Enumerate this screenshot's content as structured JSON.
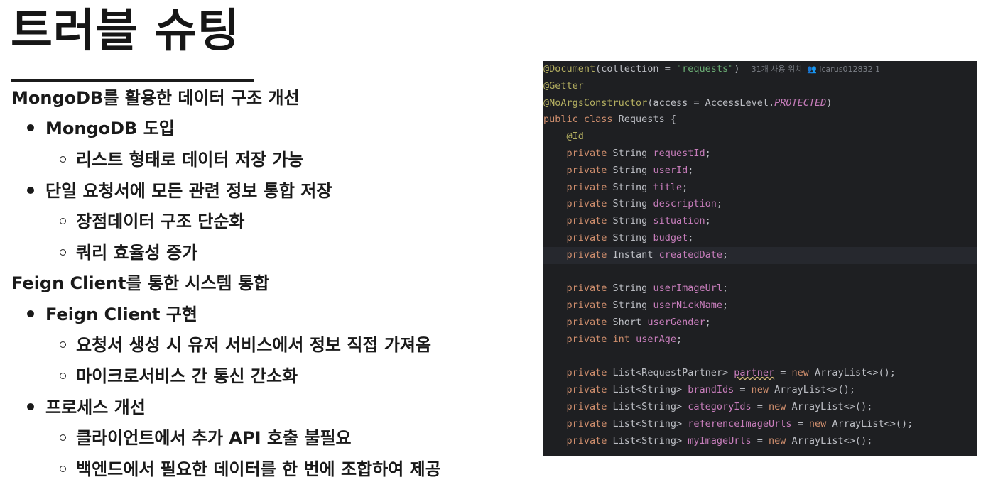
{
  "title": "트러블 슈팅",
  "outline": [
    {
      "level": 0,
      "text": "MongoDB를 활용한 데이터 구조 개선"
    },
    {
      "level": 1,
      "text": "MongoDB 도입"
    },
    {
      "level": 2,
      "text": "리스트 형태로 데이터 저장 가능"
    },
    {
      "level": 1,
      "text": "단일 요청서에 모든 관련 정보 통합 저장"
    },
    {
      "level": 2,
      "text": "장점데이터 구조 단순화"
    },
    {
      "level": 2,
      "text": "쿼리 효율성 증가"
    },
    {
      "level": 0,
      "text": "Feign Client를 통한 시스템 통합"
    },
    {
      "level": 1,
      "text": "Feign Client 구현"
    },
    {
      "level": 2,
      "text": "요청서 생성 시 유저 서비스에서 정보 직접 가져옴"
    },
    {
      "level": 2,
      "text": "마이크로서비스 간 통신 간소화"
    },
    {
      "level": 1,
      "text": "프로세스 개선"
    },
    {
      "level": 2,
      "text": "클라이언트에서 추가 API 호출 불필요"
    },
    {
      "level": 2,
      "text": "백엔드에서 필요한 데이터를 한 번에 조합하여 제공"
    }
  ],
  "code": {
    "lines": [
      [
        {
          "t": "@Document",
          "c": "ann"
        },
        {
          "t": "(collection = "
        },
        {
          "t": "\"requests\"",
          "c": "str"
        },
        {
          "t": ")  "
        },
        {
          "t": "31개 사용 위치  ",
          "c": "hint"
        },
        {
          "t": "👥 icarus012832 1",
          "c": "hint"
        }
      ],
      [
        {
          "t": "@Getter",
          "c": "ann"
        }
      ],
      [
        {
          "t": "@NoArgsConstructor",
          "c": "ann"
        },
        {
          "t": "(access = AccessLevel."
        },
        {
          "t": "PROTECTED",
          "c": "it"
        },
        {
          "t": ")"
        }
      ],
      [
        {
          "t": "public class ",
          "c": "kw"
        },
        {
          "t": "Requests {"
        }
      ],
      [
        {
          "t": "    "
        },
        {
          "t": "@Id",
          "c": "ann"
        }
      ],
      [
        {
          "t": "    "
        },
        {
          "t": "private ",
          "c": "kw"
        },
        {
          "t": "String "
        },
        {
          "t": "requestId",
          "c": "fld"
        },
        {
          "t": ";"
        }
      ],
      [
        {
          "t": "    "
        },
        {
          "t": "private ",
          "c": "kw"
        },
        {
          "t": "String "
        },
        {
          "t": "userId",
          "c": "fld"
        },
        {
          "t": ";"
        }
      ],
      [
        {
          "t": "    "
        },
        {
          "t": "private ",
          "c": "kw"
        },
        {
          "t": "String "
        },
        {
          "t": "title",
          "c": "fld"
        },
        {
          "t": ";"
        }
      ],
      [
        {
          "t": "    "
        },
        {
          "t": "private ",
          "c": "kw"
        },
        {
          "t": "String "
        },
        {
          "t": "description",
          "c": "fld"
        },
        {
          "t": ";"
        }
      ],
      [
        {
          "t": "    "
        },
        {
          "t": "private ",
          "c": "kw"
        },
        {
          "t": "String "
        },
        {
          "t": "situation",
          "c": "fld"
        },
        {
          "t": ";"
        }
      ],
      [
        {
          "t": "    "
        },
        {
          "t": "private ",
          "c": "kw"
        },
        {
          "t": "String "
        },
        {
          "t": "budget",
          "c": "fld"
        },
        {
          "t": ";"
        }
      ],
      [
        {
          "t": "    "
        },
        {
          "t": "private ",
          "c": "kw"
        },
        {
          "t": "Instant "
        },
        {
          "t": "createdDate",
          "c": "fld"
        },
        {
          "t": ";"
        }
      ],
      [],
      [
        {
          "t": "    "
        },
        {
          "t": "private ",
          "c": "kw"
        },
        {
          "t": "String "
        },
        {
          "t": "userImageUrl",
          "c": "fld"
        },
        {
          "t": ";"
        }
      ],
      [
        {
          "t": "    "
        },
        {
          "t": "private ",
          "c": "kw"
        },
        {
          "t": "String "
        },
        {
          "t": "userNickName",
          "c": "fld"
        },
        {
          "t": ";"
        }
      ],
      [
        {
          "t": "    "
        },
        {
          "t": "private ",
          "c": "kw"
        },
        {
          "t": "Short "
        },
        {
          "t": "userGender",
          "c": "fld"
        },
        {
          "t": ";"
        }
      ],
      [
        {
          "t": "    "
        },
        {
          "t": "private int ",
          "c": "kw"
        },
        {
          "t": "userAge",
          "c": "fld"
        },
        {
          "t": ";"
        }
      ],
      [],
      [
        {
          "t": "    "
        },
        {
          "t": "private ",
          "c": "kw"
        },
        {
          "t": "List<RequestPartner> "
        },
        {
          "t": "partner",
          "c": "fld warn"
        },
        {
          "t": " = "
        },
        {
          "t": "new ",
          "c": "kw"
        },
        {
          "t": "ArrayList<>();"
        }
      ],
      [
        {
          "t": "    "
        },
        {
          "t": "private ",
          "c": "kw"
        },
        {
          "t": "List<String> "
        },
        {
          "t": "brandIds",
          "c": "fld"
        },
        {
          "t": " = "
        },
        {
          "t": "new ",
          "c": "kw"
        },
        {
          "t": "ArrayList<>();"
        }
      ],
      [
        {
          "t": "    "
        },
        {
          "t": "private ",
          "c": "kw"
        },
        {
          "t": "List<String> "
        },
        {
          "t": "categoryIds",
          "c": "fld"
        },
        {
          "t": " = "
        },
        {
          "t": "new ",
          "c": "kw"
        },
        {
          "t": "ArrayList<>();"
        }
      ],
      [
        {
          "t": "    "
        },
        {
          "t": "private ",
          "c": "kw"
        },
        {
          "t": "List<String> "
        },
        {
          "t": "referenceImageUrls",
          "c": "fld"
        },
        {
          "t": " = "
        },
        {
          "t": "new ",
          "c": "kw"
        },
        {
          "t": "ArrayList<>();"
        }
      ],
      [
        {
          "t": "    "
        },
        {
          "t": "private ",
          "c": "kw"
        },
        {
          "t": "List<String> "
        },
        {
          "t": "myImageUrls",
          "c": "fld"
        },
        {
          "t": " = "
        },
        {
          "t": "new ",
          "c": "kw"
        },
        {
          "t": "ArrayList<>();"
        }
      ]
    ],
    "highlighted_line": 11
  }
}
